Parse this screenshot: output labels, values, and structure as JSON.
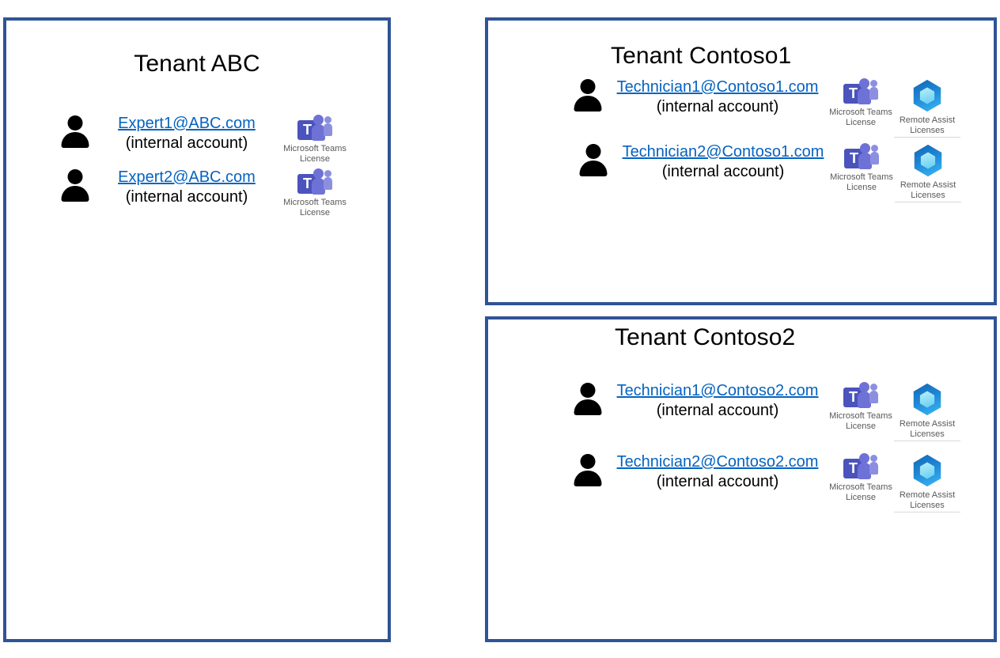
{
  "diagram": {
    "title_style_color": "#000000",
    "panel_border_color": "#2F5496",
    "link_color": "#0563C1",
    "caption_color": "#595959"
  },
  "licenses_catalog": {
    "teams": {
      "icon": "microsoft-teams-icon",
      "caption": "Microsoft Teams License",
      "letter": "T",
      "colors": {
        "square": "#4B53BC",
        "person_large": "#6E72D6",
        "person_small": "#8C8FE0"
      }
    },
    "remote_assist": {
      "icon": "remote-assist-icon",
      "caption": "Remote Assist Licenses",
      "colors": {
        "hex_outer_dark": "#1B6FC2",
        "hex_outer_light": "#2EA3E8",
        "hex_inner": "#8FE0F5"
      }
    }
  },
  "panels": [
    {
      "id": "abc",
      "title": "Tenant ABC",
      "users": [
        {
          "icon": "person-icon",
          "email": "Expert1@ABC.com",
          "account_type": "(internal account)",
          "licenses": [
            {
              "key": "teams",
              "caption": "Microsoft Teams License"
            }
          ]
        },
        {
          "icon": "person-icon",
          "email": "Expert2@ABC.com",
          "account_type": "(internal account)",
          "licenses": [
            {
              "key": "teams",
              "caption": "Microsoft Teams License"
            }
          ]
        }
      ]
    },
    {
      "id": "contoso1",
      "title": "Tenant Contoso1",
      "users": [
        {
          "icon": "person-icon",
          "email": "Technician1@Contoso1.com",
          "account_type": "(internal account)",
          "licenses": [
            {
              "key": "teams",
              "caption": "Microsoft Teams License"
            },
            {
              "key": "remote_assist",
              "caption": "Remote Assist Licenses"
            }
          ]
        },
        {
          "icon": "person-icon",
          "email": "Technician2@Contoso1.com",
          "account_type": "(internal account)",
          "licenses": [
            {
              "key": "teams",
              "caption": "Microsoft Teams License"
            },
            {
              "key": "remote_assist",
              "caption": "Remote Assist Licenses"
            }
          ]
        }
      ]
    },
    {
      "id": "contoso2",
      "title": "Tenant Contoso2",
      "users": [
        {
          "icon": "person-icon",
          "email": "Technician1@Contoso2.com",
          "account_type": "(internal account)",
          "licenses": [
            {
              "key": "teams",
              "caption": "Microsoft Teams License"
            },
            {
              "key": "remote_assist",
              "caption": "Remote Assist Licenses"
            }
          ]
        },
        {
          "icon": "person-icon",
          "email": "Technician2@Contoso2.com",
          "account_type": "(internal account)",
          "licenses": [
            {
              "key": "teams",
              "caption": "Microsoft Teams License"
            },
            {
              "key": "remote_assist",
              "caption": "Remote Assist Licenses"
            }
          ]
        }
      ]
    }
  ]
}
